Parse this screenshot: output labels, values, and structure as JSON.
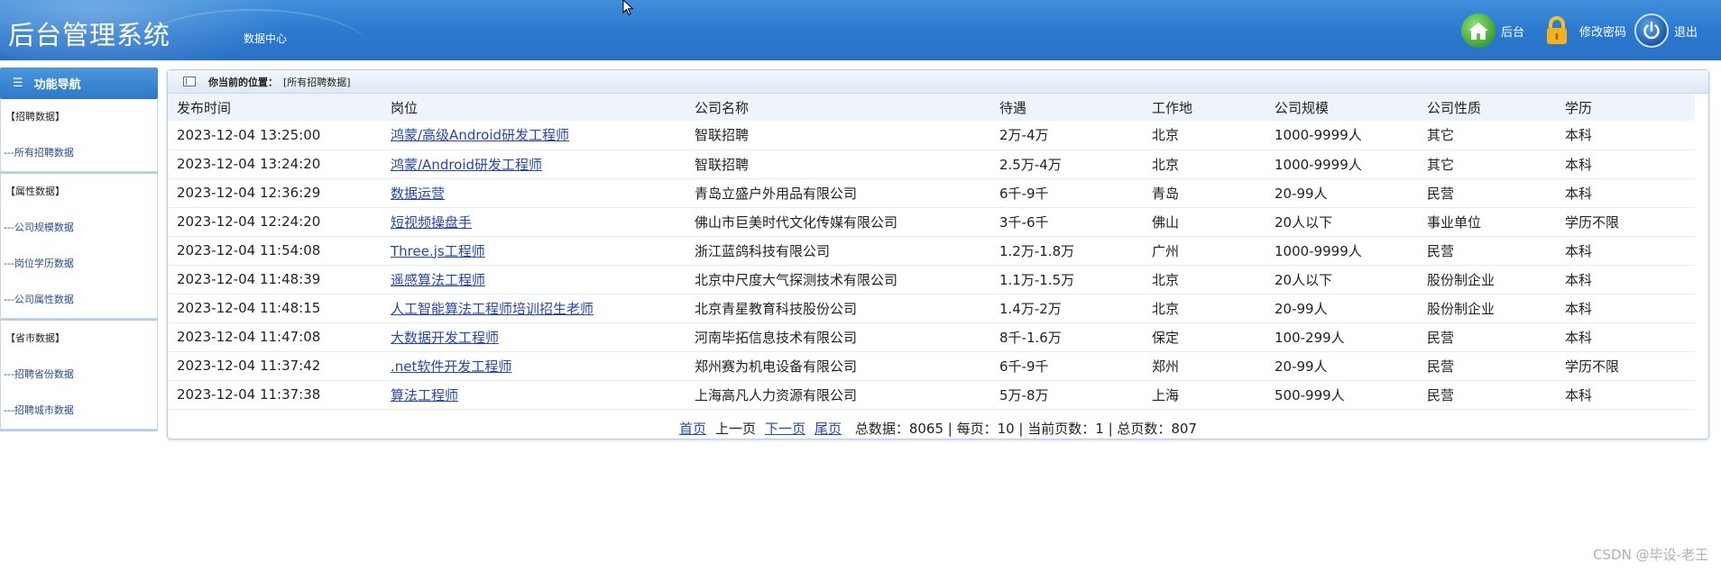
{
  "header": {
    "title": "后台管理系统",
    "data_center": "数据中心",
    "home_label": "后台",
    "change_pwd_label": "修改密码",
    "logout_label": "退出"
  },
  "sidebar": {
    "nav_title": "功能导航",
    "groups": [
      {
        "title": "【招聘数据】",
        "items": [
          "---所有招聘数据"
        ]
      },
      {
        "title": "【属性数据】",
        "items": [
          "---公司规模数据",
          "---岗位学历数据",
          "---公司属性数据"
        ]
      },
      {
        "title": "【省市数据】",
        "items": [
          "---招聘省份数据",
          "---招聘城市数据"
        ]
      }
    ]
  },
  "breadcrumb": {
    "label": "你当前的位置：",
    "value": "[所有招聘数据]"
  },
  "table": {
    "headers": [
      "发布时间",
      "岗位",
      "公司名称",
      "待遇",
      "工作地",
      "公司规模",
      "公司性质",
      "学历"
    ],
    "rows": [
      [
        "2023-12-04 13:25:00",
        "鸿蒙/高级Android研发工程师",
        "智联招聘",
        "2万-4万",
        "北京",
        "1000-9999人",
        "其它",
        "本科"
      ],
      [
        "2023-12-04 13:24:20",
        "鸿蒙/Android研发工程师",
        "智联招聘",
        "2.5万-4万",
        "北京",
        "1000-9999人",
        "其它",
        "本科"
      ],
      [
        "2023-12-04 12:36:29",
        "数据运营",
        "青岛立盛户外用品有限公司",
        "6千-9千",
        "青岛",
        "20-99人",
        "民营",
        "本科"
      ],
      [
        "2023-12-04 12:24:20",
        "短视频操盘手",
        "佛山市巨美时代文化传媒有限公司",
        "3千-6千",
        "佛山",
        "20人以下",
        "事业单位",
        "学历不限"
      ],
      [
        "2023-12-04 11:54:08",
        "Three.js工程师",
        "浙江蓝鸽科技有限公司",
        "1.2万-1.8万",
        "广州",
        "1000-9999人",
        "民营",
        "本科"
      ],
      [
        "2023-12-04 11:48:39",
        "遥感算法工程师",
        "北京中尺度大气探测技术有限公司",
        "1.1万-1.5万",
        "北京",
        "20人以下",
        "股份制企业",
        "本科"
      ],
      [
        "2023-12-04 11:48:15",
        "人工智能算法工程师培训招生老师",
        "北京青星教育科技股份公司",
        "1.4万-2万",
        "北京",
        "20-99人",
        "股份制企业",
        "本科"
      ],
      [
        "2023-12-04 11:47:08",
        "大数据开发工程师",
        "河南毕拓信息技术有限公司",
        "8千-1.6万",
        "保定",
        "100-299人",
        "民营",
        "本科"
      ],
      [
        "2023-12-04 11:37:42",
        ".net软件开发工程师",
        "郑州赛为机电设备有限公司",
        "6千-9千",
        "郑州",
        "20-99人",
        "民营",
        "学历不限"
      ],
      [
        "2023-12-04 11:37:38",
        "算法工程师",
        "上海高凡人力资源有限公司",
        "5万-8万",
        "上海",
        "500-999人",
        "民营",
        "本科"
      ]
    ]
  },
  "pager": {
    "first": "首页",
    "prev": "上一页",
    "next": "下一页",
    "last": "尾页",
    "summary": "总数据：8065 | 每页：10 | 当前页数：1 | 总页数：807"
  },
  "watermark": "CSDN @毕设-老王",
  "colors": {
    "header_blue": "#2a78cf",
    "link": "#2a46a8"
  }
}
